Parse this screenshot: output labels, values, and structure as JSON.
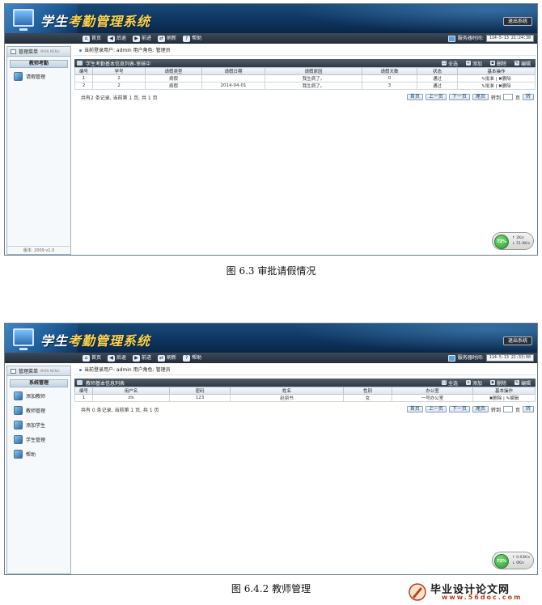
{
  "app": {
    "title_part1": "学生",
    "title_part2": "考勤管理系统",
    "logout_label": "退出系统",
    "nav": [
      "首页",
      "后退",
      "前进",
      "刷新",
      "帮助"
    ],
    "server_time_label": "服务器时间:",
    "menu_label": "管理菜单",
    "menu_en": "MAIN MENU",
    "current_user_text": "当前登录用户: admin  用户角色: 管理员",
    "tools": {
      "select_all": "全选",
      "add": "添加",
      "delete": "删除",
      "edit": "编辑"
    },
    "pager": {
      "first": "首页",
      "prev": "上一页",
      "next": "下一页",
      "last": "尾页",
      "goto": "转到",
      "page_unit": "页",
      "go": "转"
    }
  },
  "screen1": {
    "server_time": "114-5-13 21:24:30",
    "sidebar_group": "教师考勤",
    "sidebar_items": [
      "请假管理"
    ],
    "sidebar_footer": "版本: 2009 v1.0",
    "panel_title": "学生考勤基本信息列表-审核中",
    "columns": [
      "编号",
      "学号",
      "请假类型",
      "请假日期",
      "请假原因",
      "请假天数",
      "状态",
      "基本操作"
    ],
    "rows": [
      {
        "id": "1",
        "student_no": "2",
        "type": "病假",
        "date": "",
        "reason": "我生病了。",
        "days": "0",
        "status": "通过",
        "ops": "✎批准 | ✖删除"
      },
      {
        "id": "2",
        "student_no": "2",
        "type": "病假",
        "date": "2014-04-01",
        "reason": "我生病了。",
        "days": "3",
        "status": "通过",
        "ops": "✎批准 | ✖删除"
      }
    ],
    "pager_summary": "共有2 条记录, 当前第 1 页, 共 1 页",
    "net_pct": "72%",
    "net_up": "2K/s",
    "net_down": "51.9K/s"
  },
  "caption1": "图 6.3  审批请假情况",
  "screen2": {
    "server_time": "114-5-13 21:33:00",
    "sidebar_group": "系统管理",
    "sidebar_items": [
      "添加教师",
      "教师管理",
      "添加学生",
      "学生管理",
      "帮助"
    ],
    "panel_title": "教师基本信息列表",
    "columns": [
      "编号",
      "用户名",
      "密码",
      "姓名",
      "性别",
      "办公室",
      "基本操作"
    ],
    "rows": [
      {
        "id": "1",
        "username": "zls",
        "password": "123",
        "name": "赵丽书",
        "gender": "女",
        "office": "一号办公室",
        "ops": "✖删除 | ✎编辑"
      }
    ],
    "pager_summary": "共有 0 条记录, 当前第 1 页, 共 1 页",
    "net_pct": "72%",
    "net_up": "0.03K/s",
    "net_down": "0K/s"
  },
  "caption2": "图 6.4.2 教师管理",
  "watermark": {
    "title": "毕业设计论文网",
    "url": "www.56doc.com"
  },
  "colors": {
    "banner": "#0e3560",
    "navbar": "#2e3944",
    "title_accent": "#ffd24a",
    "watermark_url": "#c03a1a"
  }
}
